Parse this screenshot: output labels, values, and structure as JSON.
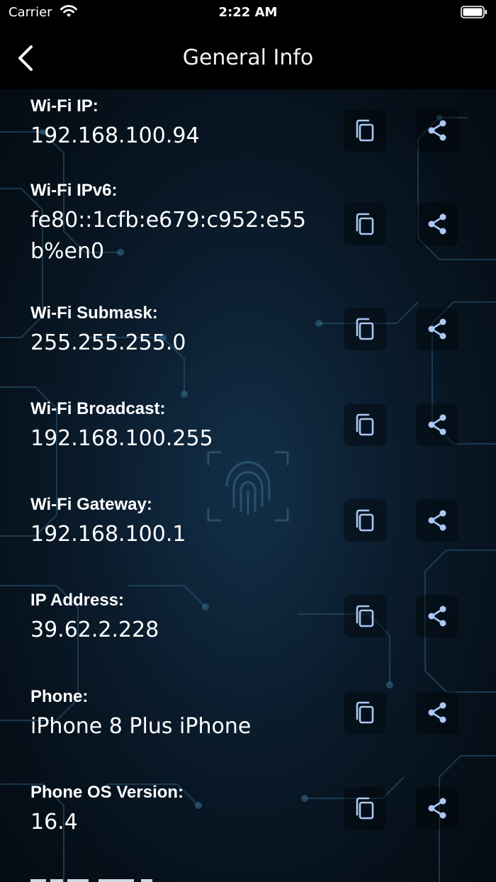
{
  "status_bar": {
    "carrier": "Carrier",
    "time": "2:22 AM"
  },
  "nav": {
    "title": "General Info"
  },
  "colors": {
    "icon": "#a9c8f2",
    "background": "#06111b"
  },
  "rows": [
    {
      "label": "Wi-Fi IP:",
      "value": "192.168.100.94"
    },
    {
      "label": "Wi-Fi IPv6:",
      "value": "fe80::1cfb:e679:c952:e55b%en0"
    },
    {
      "label": "Wi-Fi Submask:",
      "value": "255.255.255.0"
    },
    {
      "label": "Wi-Fi Broadcast:",
      "value": "192.168.100.255"
    },
    {
      "label": "Wi-Fi Gateway:",
      "value": "192.168.100.1"
    },
    {
      "label": "IP Address:",
      "value": "39.62.2.228"
    },
    {
      "label": "Phone:",
      "value": "iPhone 8 Plus iPhone"
    },
    {
      "label": "Phone OS Version:",
      "value": "16.4"
    }
  ]
}
